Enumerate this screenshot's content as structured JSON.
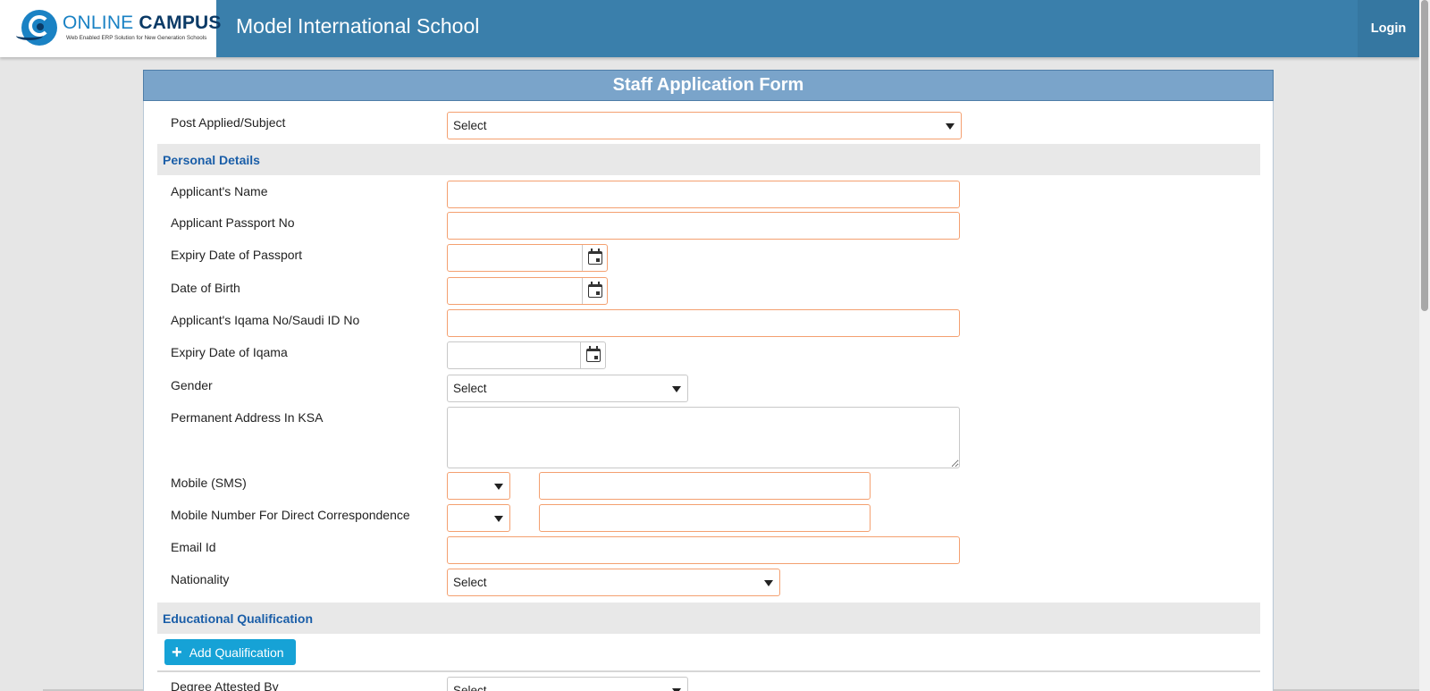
{
  "header": {
    "logo_online": "ONLINE ",
    "logo_campus": "CAMPUS",
    "logo_tagline": "Web Enabled ERP Solution for New Generation Schools",
    "school_name": "Model International School",
    "login_label": "Login"
  },
  "form": {
    "title": "Staff Application Form",
    "post_applied": {
      "label": "Post Applied/Subject",
      "value": "Select"
    },
    "sections": {
      "personal": "Personal Details",
      "education": "Educational Qualification"
    },
    "personal": {
      "name_label": "Applicant's Name",
      "passport_label": "Applicant Passport No",
      "passport_expiry_label": "Expiry Date of Passport",
      "dob_label": "Date of Birth",
      "iqama_label": "Applicant's Iqama No/Saudi ID No",
      "iqama_expiry_label": "Expiry Date of Iqama",
      "gender_label": "Gender",
      "gender_value": "Select",
      "address_label": "Permanent Address In KSA",
      "mobile_sms_label": "Mobile (SMS)",
      "mobile_direct_label": "Mobile Number For Direct Correspondence",
      "email_label": "Email Id",
      "nationality_label": "Nationality",
      "nationality_value": "Select"
    },
    "education": {
      "add_label": "Add Qualification",
      "attested_label": "Degree Attested By",
      "attested_value": "Select"
    }
  },
  "colors": {
    "header_bg": "#3a7fab",
    "title_bg": "#7aa4ca",
    "section_text": "#1a5ea8",
    "field_border": "#f4a070",
    "button_bg": "#16a2d6"
  },
  "icons": [
    "logo-icon",
    "calendar-icon",
    "chevron-down-icon",
    "plus-icon"
  ]
}
